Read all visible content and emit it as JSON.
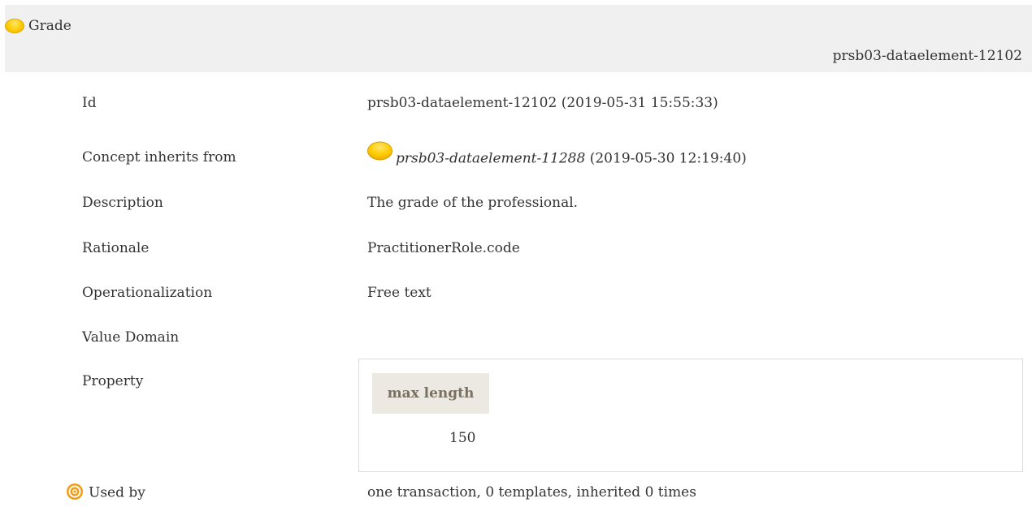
{
  "header": {
    "title": "Grade",
    "id": "prsb03-dataelement-12102"
  },
  "rows": {
    "id": {
      "label": "Id",
      "value": "prsb03-dataelement-12102 (2019-05-31 15:55:33)"
    },
    "inherits": {
      "label": "Concept inherits from",
      "link": "prsb03-dataelement-11288",
      "date": "(2019-05-30 12:19:40)"
    },
    "description": {
      "label": "Description",
      "value": "The grade of the professional."
    },
    "rationale": {
      "label": "Rationale",
      "value": "PractitionerRole.code"
    },
    "operationalization": {
      "label": "Operationalization",
      "value": "Free text"
    },
    "value_domain": {
      "label": "Value Domain"
    },
    "property": {
      "label": "Property",
      "column_header": "max length",
      "value": "150"
    },
    "used_by": {
      "label": "Used by",
      "value": "one transaction, 0 templates, inherited 0 times"
    }
  },
  "icons": {
    "concept": "yellow-concept-icon",
    "used_by": "target-icon"
  },
  "colors": {
    "concept_icon": "#ffcc00",
    "used_by_icon": "#f39c12",
    "header_background": "#f0f0f0"
  }
}
